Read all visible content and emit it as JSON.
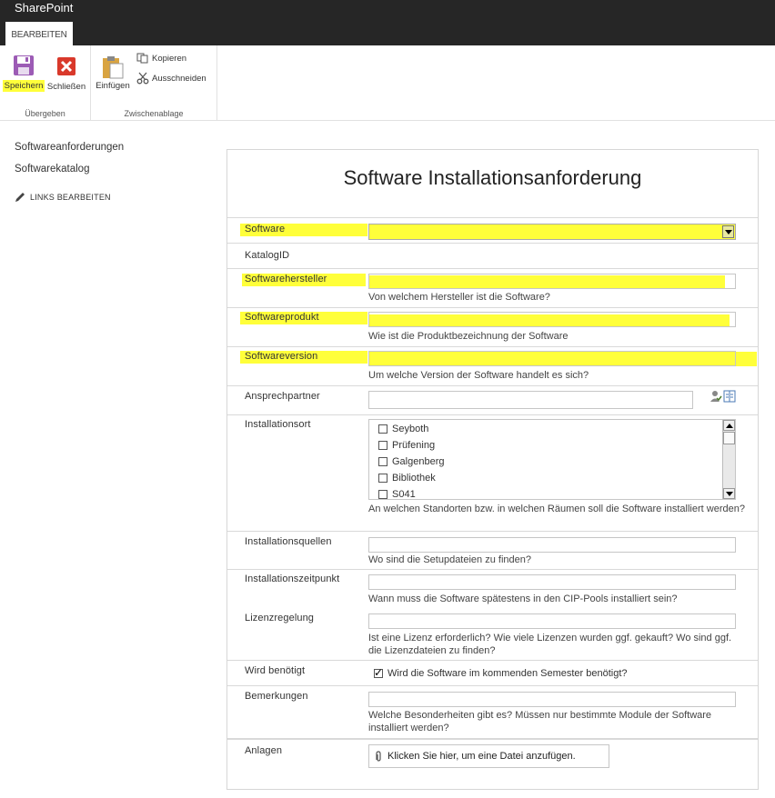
{
  "suite": {
    "brand": "SharePoint"
  },
  "ribbon": {
    "tab": "BEARBEITEN",
    "save": "Speichern",
    "close": "Schließen",
    "paste": "Einfügen",
    "copy": "Kopieren",
    "cut": "Ausschneiden",
    "group_commit": "Übergeben",
    "group_clipboard": "Zwischenablage"
  },
  "nav": {
    "items": [
      "Softwareanforderungen",
      "Softwarekatalog"
    ],
    "edit_links": "LINKS BEARBEITEN"
  },
  "form": {
    "title": "Software Installationsanforderung",
    "fields": {
      "software": {
        "label": "Software",
        "value": ""
      },
      "katalogid": {
        "label": "KatalogID"
      },
      "hersteller": {
        "label": "Softwarehersteller",
        "value": "",
        "desc": "Von welchem Hersteller ist die Software?"
      },
      "produkt": {
        "label": "Softwareprodukt",
        "value": "",
        "desc": "Wie ist die Produktbezeichnung der Software"
      },
      "version": {
        "label": "Softwareversion",
        "value": "",
        "desc": "Um welche Version der Software handelt es sich?"
      },
      "ansprech": {
        "label": "Ansprechpartner",
        "value": ""
      },
      "ort": {
        "label": "Installationsort",
        "options": [
          "Seyboth",
          "Prüfening",
          "Galgenberg",
          "Bibliothek",
          "S041"
        ],
        "desc": "An welchen Standorten bzw. in welchen Räumen soll die Software installiert werden?"
      },
      "quellen": {
        "label": "Installationsquellen",
        "value": "",
        "desc": "Wo sind die Setupdateien zu finden?"
      },
      "zeitpunkt": {
        "label": "Installationszeitpunkt",
        "value": "",
        "desc": "Wann muss die Software spätestens in den CIP-Pools installiert sein?"
      },
      "lizenz": {
        "label": "Lizenzregelung",
        "value": "",
        "desc": "Ist eine Lizenz erforderlich? Wie viele Lizenzen wurden ggf. gekauft? Wo sind ggf. die Lizenzdateien zu finden?"
      },
      "benoetigt": {
        "label": "Wird benötigt",
        "checkbox_label": "Wird die Software im kommenden Semester benötigt?",
        "checked": true
      },
      "bemerkungen": {
        "label": "Bemerkungen",
        "value": "",
        "desc": "Welche Besonderheiten gibt es? Müssen nur bestimmte Module der Software installiert werden?"
      },
      "anlagen": {
        "label": "Anlagen",
        "button": "Klicken Sie hier, um eine Datei anzufügen."
      }
    }
  },
  "colors": {
    "highlight": "#ffff3a",
    "suitebar": "#262626",
    "save_icon": "#9c5bb5",
    "close_icon": "#d9392b"
  }
}
